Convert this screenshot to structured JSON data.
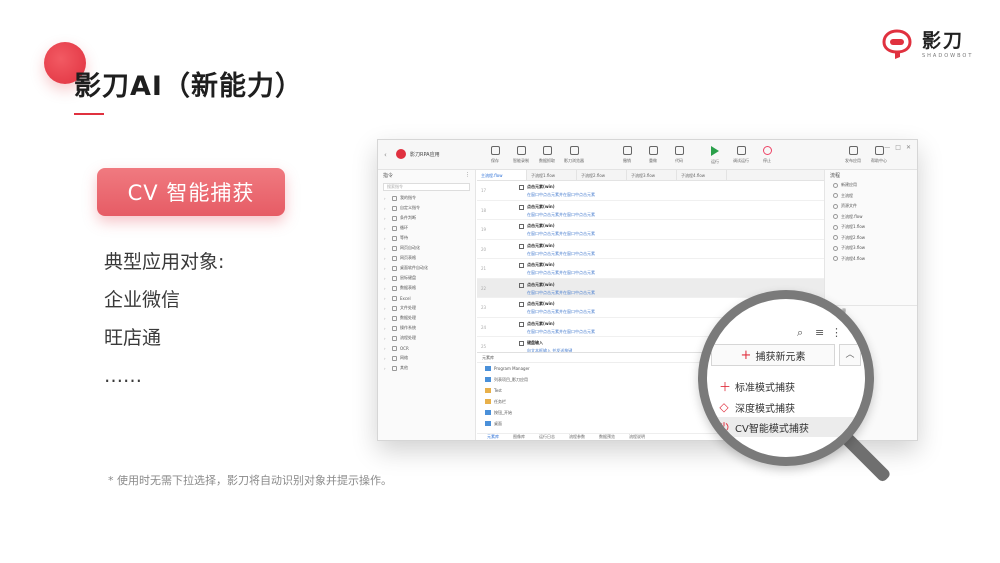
{
  "slide": {
    "title": "影刀AI（新能力）",
    "badge": "CV 智能捕获",
    "targets": [
      "典型应用对象:",
      "企业微信",
      "旺店通",
      "……"
    ],
    "footnote": "* 使用时无需下拉选择，影刀将自动识别对象并提示操作。",
    "colors": {
      "accent": "#e0313f",
      "badge": "#e65c65"
    }
  },
  "logo": {
    "text": "影刀",
    "sub": "SHADOWBOT"
  },
  "app": {
    "back": "‹",
    "project_name": "影刀RPA应用",
    "toolbar_left": [
      {
        "label": "保存",
        "icon": "save-icon"
      },
      {
        "label": "智能录制",
        "icon": "record-icon"
      },
      {
        "label": "数据抓取",
        "icon": "grab-icon"
      },
      {
        "label": "影刀浏览器",
        "icon": "browser-icon"
      }
    ],
    "toolbar_mid": [
      {
        "label": "撤销",
        "icon": "undo-icon"
      },
      {
        "label": "重做",
        "icon": "redo-icon"
      },
      {
        "label": "代码",
        "icon": "code-icon"
      }
    ],
    "toolbar_run": [
      {
        "label": "运行",
        "icon": "play-icon"
      },
      {
        "label": "调试运行",
        "icon": "debug-icon"
      },
      {
        "label": "停止",
        "icon": "stop-icon"
      }
    ],
    "toolbar_right": [
      {
        "label": "发布应用",
        "icon": "publish-icon"
      },
      {
        "label": "帮助中心",
        "icon": "help-icon"
      }
    ],
    "window_controls": [
      "—",
      "□",
      "✕"
    ],
    "left_panel": {
      "title": "指令",
      "search_placeholder": "搜索指令",
      "items": [
        "我的指令",
        "自定义指令",
        "条件判断",
        "循环",
        "等待",
        "网页自动化",
        "网页表格",
        "桌面软件自动化",
        "鼠标键盘",
        "数据表格",
        "Excel",
        "文件处理",
        "数据处理",
        "操作系统",
        "流程处理",
        "OCR",
        "网络",
        "其他"
      ]
    },
    "tabs": [
      "主流程.flow",
      "子流程1.flow",
      "子流程2.flow",
      "子流程3.flow",
      "子流程4.flow"
    ],
    "rows": [
      {
        "line": "17",
        "title": "点击元素(win)",
        "desc": "在窗口中点击元素并在窗口中点击元素"
      },
      {
        "line": "18",
        "title": "点击元素(win)",
        "desc": "在窗口中点击元素并在窗口中点击元素"
      },
      {
        "line": "19",
        "title": "点击元素(win)",
        "desc": "在窗口中点击元素并在窗口中点击元素"
      },
      {
        "line": "20",
        "title": "点击元素(win)",
        "desc": "在窗口中点击元素并在窗口中点击元素"
      },
      {
        "line": "21",
        "title": "点击元素(win)",
        "desc": "在窗口中点击元素并在窗口中点击元素"
      },
      {
        "line": "22",
        "title": "点击元素(win)",
        "desc": "在窗口中点击元素并在窗口中点击元素"
      },
      {
        "line": "23",
        "title": "点击元素(win)",
        "desc": "在窗口中点击元素并在窗口中点击元素"
      },
      {
        "line": "24",
        "title": "点击元素(win)",
        "desc": "在窗口中点击元素并在窗口中点击元素"
      },
      {
        "line": "25",
        "title": "键盘输入",
        "desc": "向文本框输入 并发送按键"
      }
    ],
    "element_panel": {
      "title": "元素库",
      "items": [
        "Program Manager",
        "列表项目_影刀应用",
        "Test",
        "任务栏",
        "按钮_开始",
        "桌面"
      ],
      "tabs": [
        "元素库",
        "图像库",
        "运行日志",
        "流程参数",
        "数据预览",
        "流程说明"
      ]
    },
    "right_panel": {
      "title": "流程",
      "items": [
        "新建应用",
        "主流程",
        "资源文件",
        "主流程.flow",
        "子流程1.flow",
        "子流程2.flow",
        "子流程3.flow",
        "子流程4.flow"
      ],
      "section2": "流程变量"
    }
  },
  "magnifier": {
    "button_label": "捕获新元素",
    "caret": "︿",
    "options": [
      {
        "label": "标准模式捕获",
        "icon": "plus-icon",
        "glyph": "＋"
      },
      {
        "label": "深度模式捕获",
        "icon": "diamond-icon",
        "glyph": "◇"
      },
      {
        "label": "CV智能模式捕获",
        "icon": "cv-icon",
        "glyph": "⏻"
      }
    ],
    "icons": [
      "search-icon",
      "sort-icon",
      "more-icon"
    ]
  }
}
